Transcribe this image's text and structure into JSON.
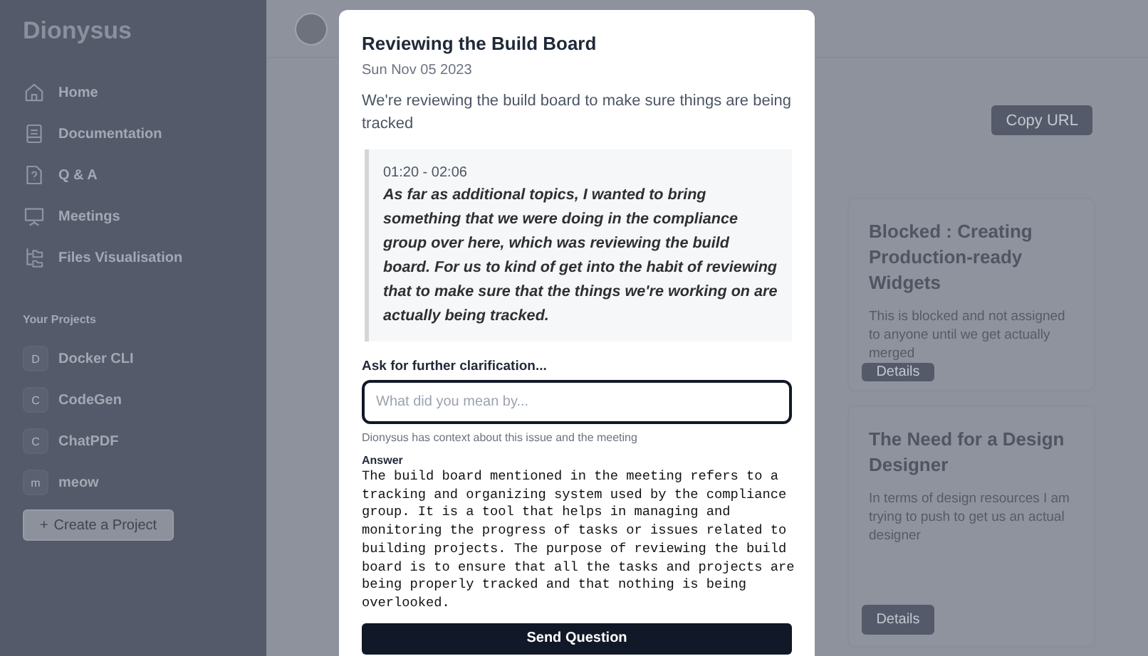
{
  "sidebar": {
    "brand": "Dionysus",
    "nav": [
      {
        "label": "Home"
      },
      {
        "label": "Documentation"
      },
      {
        "label": "Q & A"
      },
      {
        "label": "Meetings"
      },
      {
        "label": "Files Visualisation"
      }
    ],
    "projects_heading": "Your Projects",
    "projects": [
      {
        "initial": "D",
        "name": "Docker CLI"
      },
      {
        "initial": "C",
        "name": "CodeGen"
      },
      {
        "initial": "C",
        "name": "ChatPDF"
      },
      {
        "initial": "m",
        "name": "meow"
      }
    ],
    "create_button": {
      "icon": "+",
      "label": "Create a Project"
    }
  },
  "main": {
    "copy_button": "Copy URL",
    "cards": [
      {
        "title": "Blocked : Creating Production-ready Widgets",
        "description": "This is blocked and not assigned to anyone until we get actually merged",
        "button": "Details"
      },
      {
        "title": "The Need for a Design Designer",
        "description": "In terms of design resources I am trying to push to get us an actual designer",
        "button": "Details"
      }
    ]
  },
  "dialog": {
    "title": "Reviewing the Build Board",
    "date": "Sun Nov 05 2023",
    "summary": "We're reviewing the build board to make sure things are being tracked",
    "quote": {
      "time": "01:20 - 02:06",
      "text": "As far as additional topics, I wanted to bring something that we were doing in the compliance group over here, which was reviewing the build board. For us to kind of get into the habit of reviewing that to make sure that the things we're working on are actually being tracked."
    },
    "question_label": "Ask for further clarification...",
    "question_placeholder": "What did you mean by...",
    "hint": "Dionysus has context about this issue and the meeting",
    "answer_label": "Answer",
    "answer": "The build board mentioned in the meeting refers to a tracking and organizing system used by the compliance group. It is a tool that helps in managing and monitoring the progress of tasks or issues related to building projects. The purpose of reviewing the build board is to ensure that all the tasks and projects are being properly tracked and that nothing is being overlooked.",
    "send_button": "Send Question"
  }
}
